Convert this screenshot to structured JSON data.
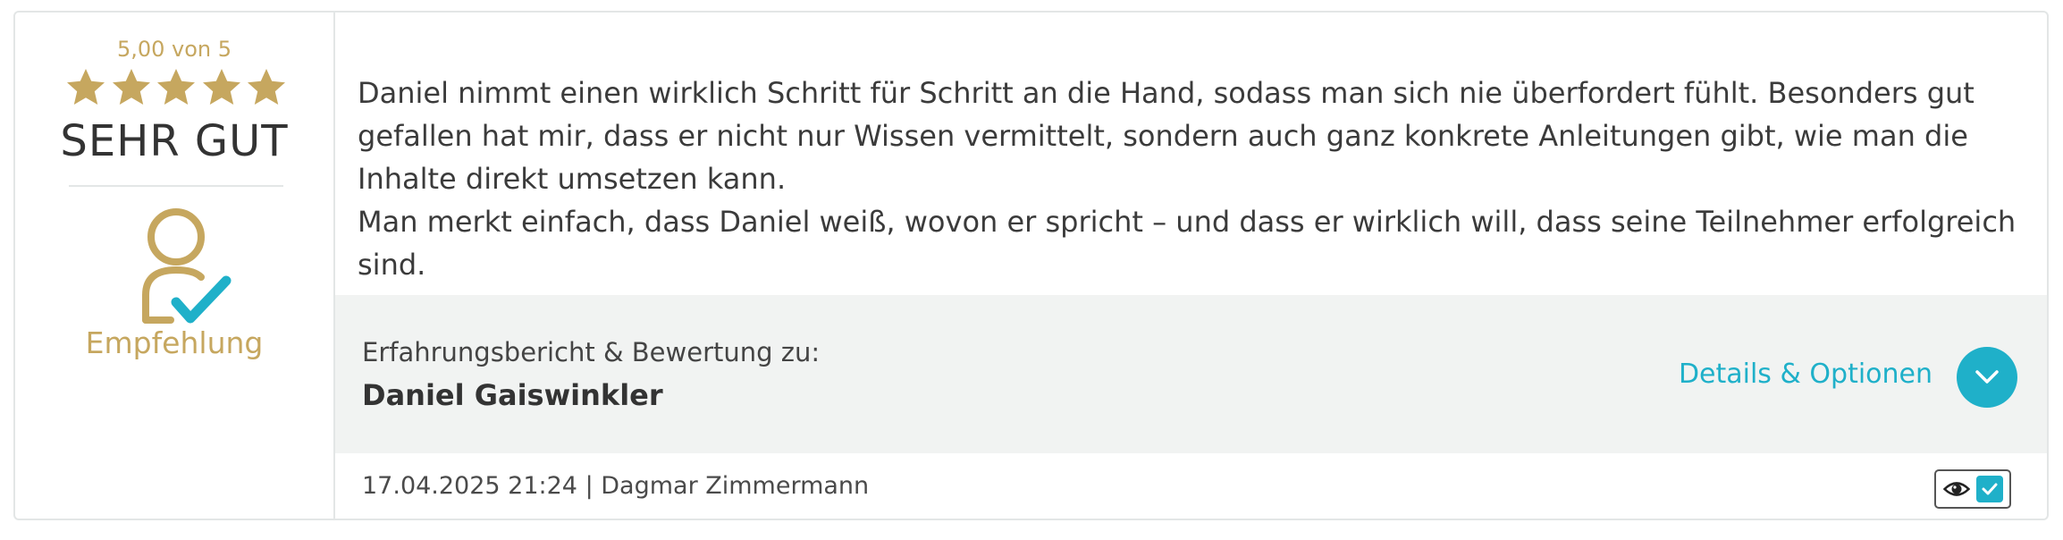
{
  "rating": {
    "score_text": "5,00 von 5",
    "stars": 5,
    "max_stars": 5,
    "label": "SEHR GUT",
    "star_color": "#c6a75f"
  },
  "recommendation": {
    "icon": "user-check-icon",
    "label": "Empfehlung"
  },
  "review": {
    "paragraphs": [
      "Daniel nimmt einen wirklich Schritt für Schritt an die Hand, sodass man sich nie überfordert fühlt. Besonders gut gefallen hat mir, dass er nicht nur Wissen vermittelt, sondern auch ganz konkrete Anleitungen gibt, wie man die Inhalte direkt umsetzen kann.",
      "Man merkt einfach, dass Daniel weiß, wovon er spricht – und dass er wirklich will, dass seine Teilnehmer erfolgreich sind."
    ]
  },
  "subject": {
    "caption": "Erfahrungsbericht & Bewertung zu:",
    "name": "Daniel Gaiswinkler",
    "details_label": "Details & Optionen",
    "details_icon": "chevron-down-icon"
  },
  "meta": {
    "line": "17.04.2025 21:24 | Dagmar Zimmermann"
  },
  "visibility": {
    "eye_icon": "eye-icon",
    "check_icon": "checkmark-icon",
    "checked": true
  },
  "colors": {
    "gold": "#c6a75f",
    "accent": "#1fb0c9",
    "text": "#3b3b3b",
    "bar_background": "#f1f3f2"
  }
}
